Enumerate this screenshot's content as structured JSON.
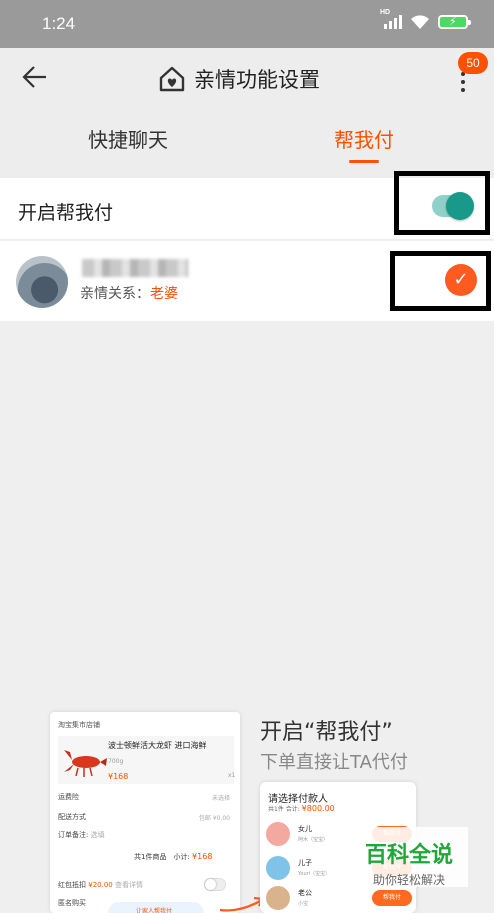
{
  "statusbar": {
    "time": "1:24",
    "hd": "HD",
    "battery": "⚡"
  },
  "header": {
    "title": "亲情功能设置",
    "badge": "50"
  },
  "tabs": [
    {
      "label": "快捷聊天"
    },
    {
      "label": "帮我付",
      "active": true
    }
  ],
  "pay_toggle": {
    "label": "开启帮我付",
    "on": true
  },
  "member": {
    "relation_label": "亲情关系：",
    "relation_value": "老婆",
    "selected": true
  },
  "promo": {
    "headline": "开启“帮我付”",
    "subline": "下单直接让TA代付",
    "order": {
      "shop": "淘宝集市店铺",
      "product_name": "波士顿鲜活大龙虾 进口海鲜",
      "weight": "700g",
      "price": "¥168",
      "qty": "x1",
      "insurance_label": "运费险",
      "insurance_value": "未选择",
      "delivery_label": "配送方式",
      "delivery_value": "包邮 ¥0.00",
      "note_label": "订单备注:",
      "note_placeholder": "选填",
      "total_prefix": "共1件商品　小计:",
      "total_value": "¥168",
      "redpacket_label": "红包抵扣",
      "redpacket_value": "¥20.00",
      "redpacket_hint": "查看详情",
      "anon_label": "匿名购买",
      "bubble_text": "让家人帮我付"
    },
    "payer_sheet": {
      "title": "请选择付款人",
      "summary_prefix": "共1件 合计:",
      "summary_value": "¥800.00",
      "payers": [
        {
          "name": "女儿",
          "sub": "阿木（宝宝）"
        },
        {
          "name": "儿子",
          "sub": "Youri（宝宝）"
        },
        {
          "name": "老公",
          "sub": "小宝"
        }
      ],
      "button_label": "帮我付"
    }
  },
  "watermark": {
    "big": "百科全说",
    "small": "助你轻松解决"
  },
  "colors": {
    "accent": "#ff5000",
    "toggle": "#19998a",
    "watermark": "#1fa83a"
  }
}
